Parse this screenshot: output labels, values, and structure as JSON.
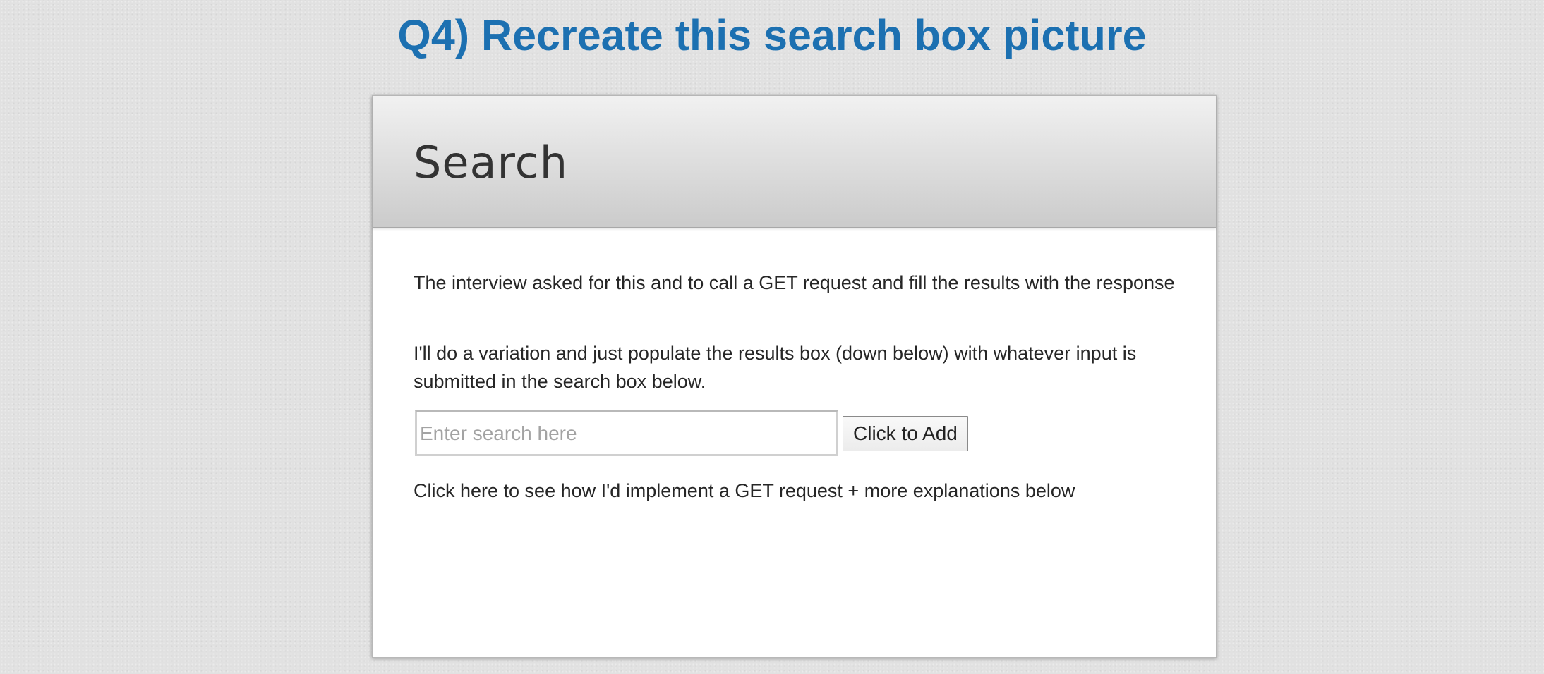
{
  "page": {
    "heading": "Q4) Recreate this search box picture"
  },
  "panel": {
    "title": "Search",
    "paragraphs": [
      "The interview asked for this and to call a GET request and fill the results with the response",
      "I'll do a variation and just populate the results box (down below) with whatever input is submitted in the search box below."
    ],
    "search": {
      "value": "",
      "placeholder": "Enter search here"
    },
    "button_label": "Click to Add",
    "link_text": "Click here to see how I'd implement a GET request + more explanations below"
  },
  "colors": {
    "heading": "#1c70b1",
    "background": "#e1e1e1",
    "panel_header_top": "#f1f1f1",
    "panel_header_bottom": "#cbcbcb"
  }
}
